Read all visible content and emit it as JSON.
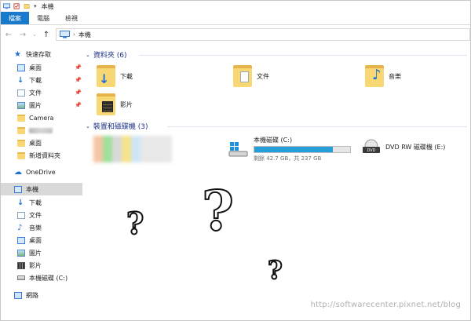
{
  "window": {
    "title": "本機"
  },
  "ribbon": {
    "tabs": [
      "檔案",
      "電腦",
      "檢視"
    ]
  },
  "address": {
    "path": "本機"
  },
  "sidebar": {
    "quick_access": "快速存取",
    "pinned": [
      {
        "label": "桌面",
        "icon": "desktop-icon"
      },
      {
        "label": "下載",
        "icon": "download-icon"
      },
      {
        "label": "文件",
        "icon": "documents-icon"
      },
      {
        "label": "圖片",
        "icon": "pictures-icon"
      }
    ],
    "recent_folders": [
      "Camera",
      "",
      "桌面",
      "新增資料夾"
    ],
    "onedrive": "OneDrive",
    "this_pc": "本機",
    "this_pc_children": [
      {
        "label": "下載",
        "icon": "download-icon"
      },
      {
        "label": "文件",
        "icon": "documents-icon"
      },
      {
        "label": "音樂",
        "icon": "music-icon"
      },
      {
        "label": "桌面",
        "icon": "desktop-icon"
      },
      {
        "label": "圖片",
        "icon": "pictures-icon"
      },
      {
        "label": "影片",
        "icon": "videos-icon"
      },
      {
        "label": "本機磁碟 (C:)",
        "icon": "drive-icon"
      }
    ],
    "network": "網路"
  },
  "main": {
    "folders_header": "資料夾 (6)",
    "folders": [
      "下載",
      "文件",
      "音樂",
      "影片"
    ],
    "devices_header": "裝置和磁碟機 (3)",
    "drive_c": {
      "name": "本機磁碟 (C:)",
      "free_text": "剩餘 42.7 GB，共 237 GB",
      "used_fraction": 0.82
    },
    "drive_e": {
      "name": "DVD RW 磁碟機 (E:)"
    }
  },
  "overlays": {
    "q1": "?",
    "q2": "?",
    "q3": "?"
  },
  "watermark": "http://softwarecenter.pixnet.net/blog",
  "colors": {
    "accent": "#1979ca",
    "drive_bar": "#26a0da",
    "header_text": "#1e3287"
  }
}
